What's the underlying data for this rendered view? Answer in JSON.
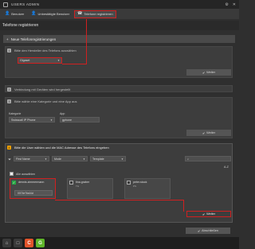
{
  "window": {
    "title": "USERS ADMIN",
    "controls": [
      "⚙",
      "✕"
    ]
  },
  "tabs": [
    {
      "icon": "👤",
      "label": "Benutzer"
    },
    {
      "icon": "👤",
      "label": "Unbestätigte Benutzer"
    },
    {
      "icon": "☎",
      "label": "Telefone registrieren"
    }
  ],
  "page": {
    "title": "Telefone registrieren"
  },
  "new_registration": {
    "label": "Neue Telefonregistrierungen"
  },
  "step1": {
    "num": "1",
    "text": "Bitte den Hersteller des Telefons auswählen",
    "select_value": "Gigaset",
    "next": "Weiter"
  },
  "step2": {
    "num": "2",
    "text": "Verbindung mit Geräten wird hergestellt"
  },
  "step3": {
    "num": "3",
    "text": "Bitte wähle eine Kategorie und eine App aus",
    "category_label": "Kategorie",
    "category_value": "Swisscall IP Phone",
    "app_label": "App",
    "app_value": "gphone",
    "next": "Weiter"
  },
  "step4": {
    "num": "4",
    "text": "Bitte die User wählen und die MAC Adresse des Telefons eingeben",
    "filters": [
      "First Name",
      "Mode",
      "Template"
    ],
    "az": "A-Z",
    "select_all": "Alle auswählen",
    "users": [
      {
        "name": "dennis.zimmermann",
        "sub": "",
        "mac": "0074e7fa44d",
        "checked": true
      },
      {
        "name": "tina.graber",
        "sub": "TG",
        "mac": "",
        "checked": false
      },
      {
        "name": "peter.stock",
        "sub": "PS",
        "mac": "",
        "checked": false
      }
    ],
    "next": "Weiter"
  },
  "abschliessen": "Abschließen",
  "bottom_toolbar": [
    "⌂",
    "□",
    "C",
    "G"
  ]
}
